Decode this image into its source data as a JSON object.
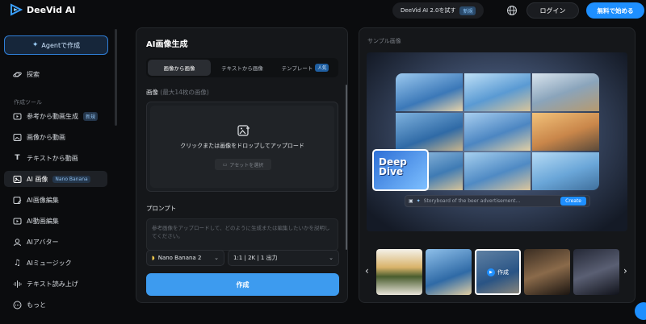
{
  "app": {
    "name": "DeeVid AI"
  },
  "header": {
    "promo_text": "DeeVid AI 2.0を試す",
    "promo_badge": "新規",
    "login_label": "ログイン",
    "start_label": "無料で始める"
  },
  "sidebar": {
    "agent_button": "Agentで作成",
    "explore": "探索",
    "section_label": "作成ツール",
    "items": [
      {
        "label": "参考から動画生成",
        "badge": "新規"
      },
      {
        "label": "画像から動画"
      },
      {
        "label": "テキストから動画"
      },
      {
        "label": "AI 画像",
        "badge": "Nano Banana"
      },
      {
        "label": "AI画像編集"
      },
      {
        "label": "AI動画編集"
      },
      {
        "label": "AIアバター"
      },
      {
        "label": "AIミュージック"
      },
      {
        "label": "テキスト読み上げ"
      },
      {
        "label": "もっと"
      }
    ]
  },
  "generator": {
    "title": "AI画像生成",
    "tabs": [
      {
        "label": "画像から画像"
      },
      {
        "label": "テキストから画像"
      },
      {
        "label": "テンプレート",
        "badge": "人気"
      }
    ],
    "image_label": "画像",
    "image_hint": "(最大14枚の画像)",
    "upload_text": "クリックまたは画像をドロップしてアップロード",
    "asset_button": "アセットを選択",
    "prompt_label": "プロンプト",
    "prompt_placeholder": "参考画像をアップロードして、どのように生成または編集したいかを説明してください。",
    "model_select": "Nano Banana 2",
    "settings_select": "1:1 | 2K | 1 出力",
    "create_button": "作成"
  },
  "sample": {
    "label": "サンプル画像",
    "ad_text_line1": "Deep",
    "ad_text_line2": "Dive",
    "pill_text": "Storyboard of the beer advertisement...",
    "pill_button": "Create",
    "selected_thumb_label": "作成"
  }
}
